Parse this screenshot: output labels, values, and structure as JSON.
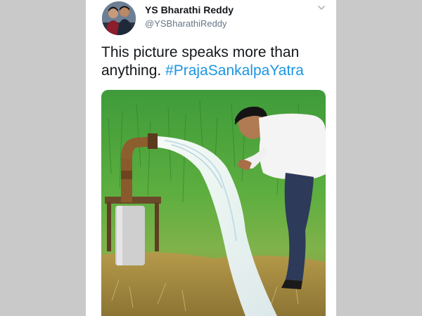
{
  "tweet": {
    "display_name": "YS Bharathi Reddy",
    "handle": "@YSBharathiReddy",
    "text_line1": "This picture speaks more than",
    "text_line2_prefix": "anything. ",
    "hashtag": "#PrajaSankalpaYatra",
    "avatar_icon": "profile-photo-couple",
    "menu_icon": "chevron-down-icon",
    "media_description_icon": "photo-man-drinking-from-borewell-pipe"
  },
  "colors": {
    "page_bg": "#c9c9c9",
    "card_bg": "#ffffff",
    "name": "#14171a",
    "handle": "#657786",
    "hashtag": "#1b95e0"
  }
}
